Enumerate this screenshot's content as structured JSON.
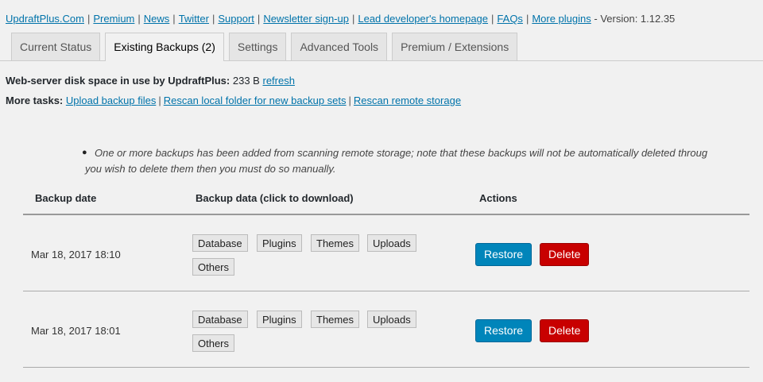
{
  "toplinks": {
    "items": [
      "UpdraftPlus.Com",
      "Premium",
      "News",
      "Twitter",
      "Support",
      "Newsletter sign-up",
      "Lead developer's homepage",
      "FAQs",
      "More plugins"
    ],
    "version": "- Version: 1.12.35"
  },
  "tabs": [
    "Current Status",
    "Existing Backups (2)",
    "Settings",
    "Advanced Tools",
    "Premium / Extensions"
  ],
  "disk": {
    "label": "Web-server disk space in use by UpdraftPlus:",
    "value": "233 B",
    "refresh": "refresh"
  },
  "more_tasks": {
    "label": "More tasks:",
    "links": [
      "Upload backup files",
      "Rescan local folder for new backup sets",
      "Rescan remote storage"
    ]
  },
  "note": {
    "line1": "One or more backups has been added from scanning remote storage; note that these backups will not be automatically deleted throug",
    "line2": "you wish to delete them then you must do so manually."
  },
  "table": {
    "headers": [
      "Backup date",
      "Backup data (click to download)",
      "Actions"
    ],
    "rows": [
      {
        "date": "Mar 18, 2017 18:10",
        "data": [
          "Database",
          "Plugins",
          "Themes",
          "Uploads",
          "Others"
        ],
        "restore": "Restore",
        "delete": "Delete"
      },
      {
        "date": "Mar 18, 2017 18:01",
        "data": [
          "Database",
          "Plugins",
          "Themes",
          "Uploads",
          "Others"
        ],
        "restore": "Restore",
        "delete": "Delete"
      }
    ]
  }
}
